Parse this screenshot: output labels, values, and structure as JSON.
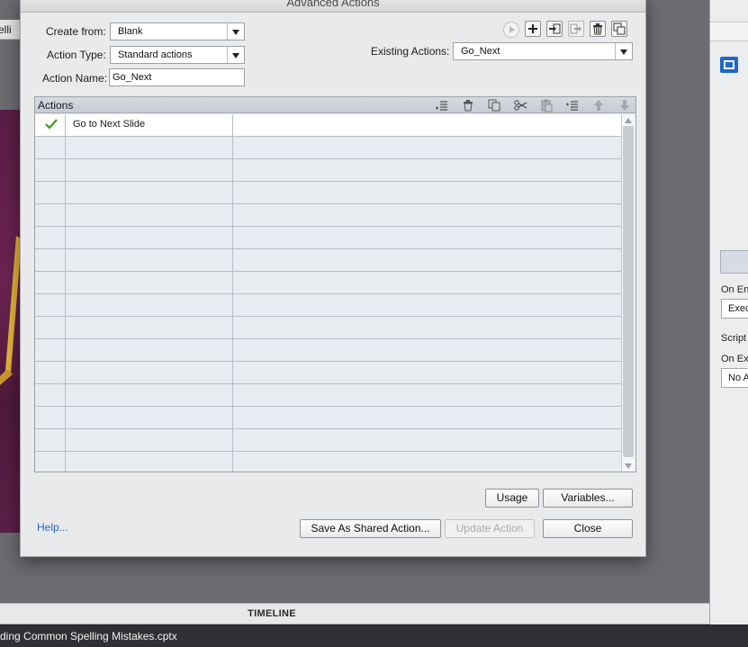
{
  "background": {
    "partial_tab_label": "elli",
    "right_panel": {
      "label_on_enter": "On En",
      "field_execute": "Exec",
      "label_script": "Script",
      "label_on_exit": "On Ex",
      "field_no_action": "No A"
    },
    "timeline_label": "TIMELINE",
    "status_filename": "ding Common Spelling Mistakes.cptx"
  },
  "dialog": {
    "title": "Advanced Actions",
    "create_from": {
      "label": "Create from:",
      "value": "Blank"
    },
    "action_type": {
      "label": "Action Type:",
      "value": "Standard actions"
    },
    "action_name": {
      "label": "Action Name:",
      "value": "Go_Next"
    },
    "existing_actions": {
      "label": "Existing Actions:",
      "value": "Go_Next"
    },
    "toolbar_icons": [
      "preview-icon",
      "add-action-icon",
      "import-icon",
      "export-icon",
      "delete-icon",
      "duplicate-icon"
    ],
    "actions_panel": {
      "title": "Actions",
      "header_icons": [
        "add-row-icon",
        "delete-row-icon",
        "copy-icon",
        "cut-icon",
        "paste-icon",
        "insert-row-icon",
        "move-up-icon",
        "move-down-icon"
      ],
      "rows": [
        {
          "checked": true,
          "command": "Go to Next Slide",
          "target": ""
        }
      ],
      "empty_rows": 15
    },
    "buttons": {
      "usage": "Usage",
      "variables": "Variables...",
      "save_shared": "Save As Shared Action...",
      "update": "Update Action",
      "close": "Close"
    },
    "help_link": "Help..."
  },
  "colors": {
    "accent_blue": "#1f66c8",
    "link_blue": "#2a66c6",
    "check_green": "#3b9a16"
  }
}
